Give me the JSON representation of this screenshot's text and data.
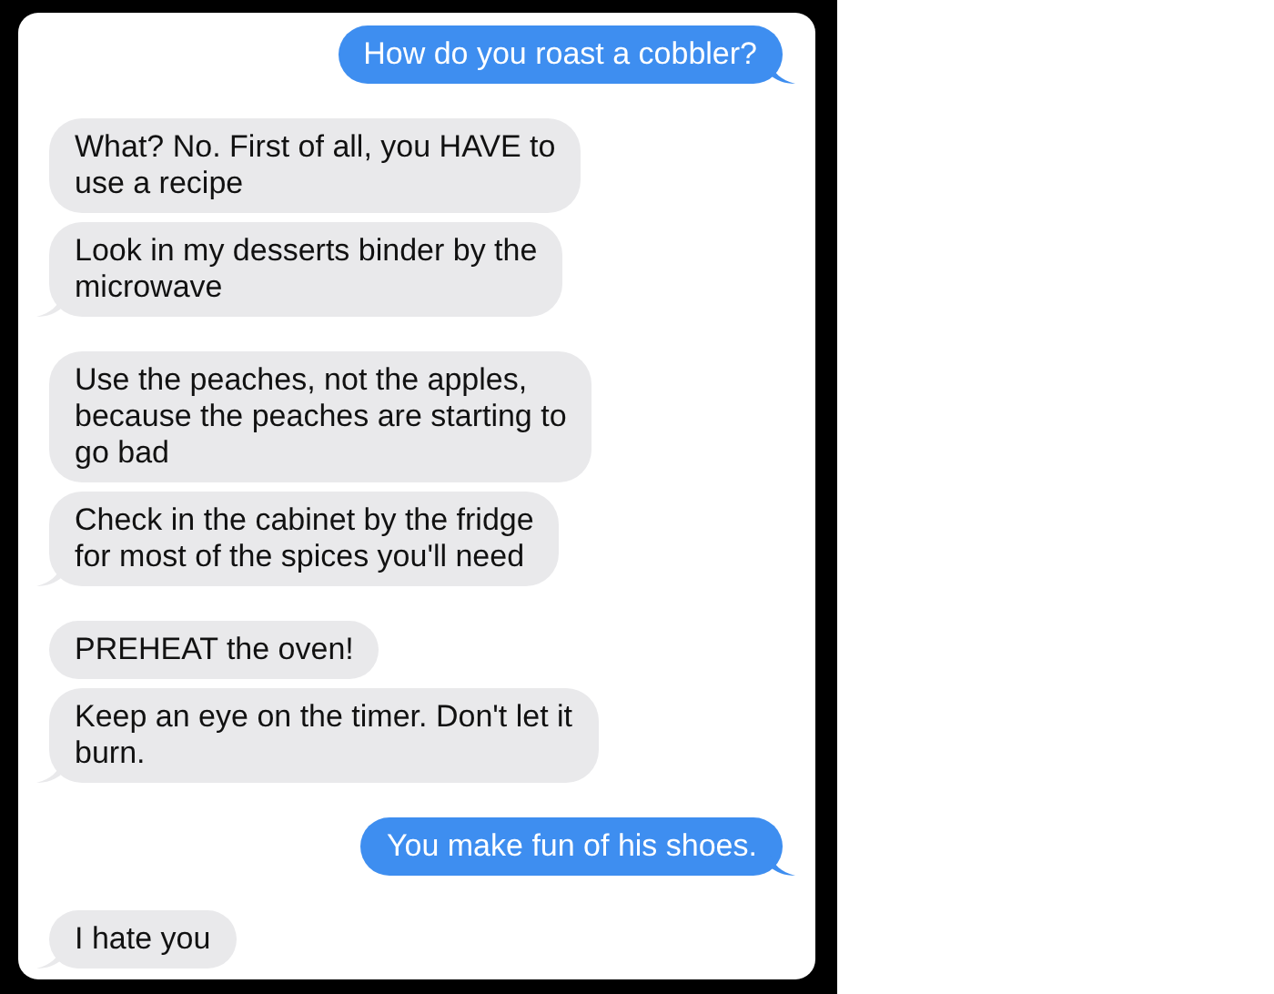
{
  "messages": [
    {
      "kind": "sent",
      "text": "How do you roast a cobbler?",
      "tail": true
    },
    {
      "kind": "received",
      "text": "What? No. First of all, you HAVE to\nuse a recipe",
      "tail": false
    },
    {
      "kind": "received",
      "text": "Look in my desserts binder by the\nmicrowave",
      "tail": true
    },
    {
      "kind": "received",
      "text": "Use the peaches, not the apples,\nbecause the peaches are starting to\ngo bad",
      "tail": false
    },
    {
      "kind": "received",
      "text": "Check in the cabinet by the fridge\nfor most of the spices you'll need",
      "tail": true
    },
    {
      "kind": "received",
      "text": "PREHEAT the oven!",
      "tail": false
    },
    {
      "kind": "received",
      "text": "Keep an eye on the timer. Don't let it\nburn.",
      "tail": true
    },
    {
      "kind": "sent",
      "text": "You make fun of his shoes.",
      "tail": true
    },
    {
      "kind": "received",
      "text": "I hate you",
      "tail": true
    }
  ]
}
